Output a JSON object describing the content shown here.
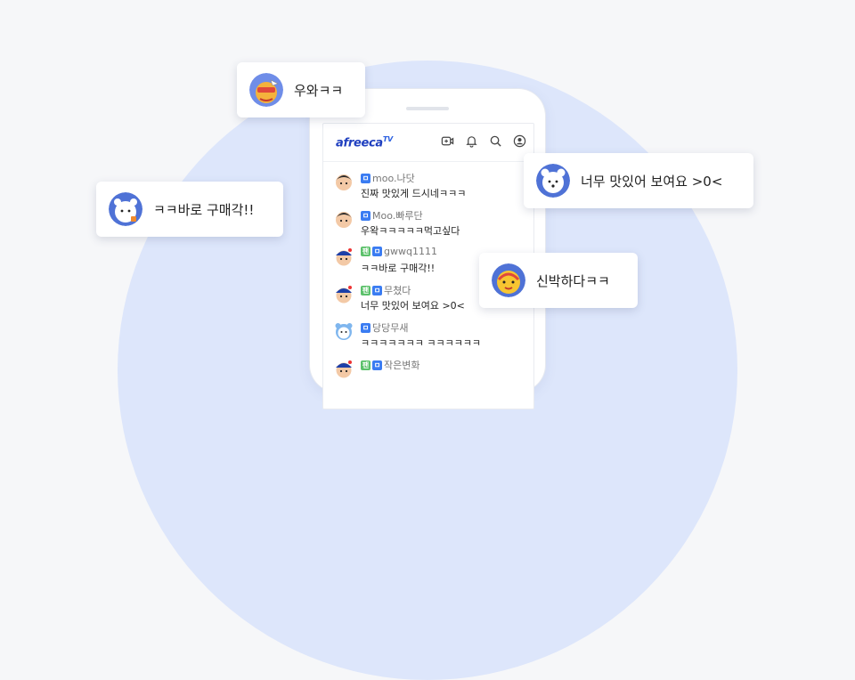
{
  "brand": {
    "logo": "afreeca",
    "logo_sup": "TV"
  },
  "topbar_icons": [
    "video-icon",
    "bell-icon",
    "search-icon",
    "profile-icon"
  ],
  "chat": [
    {
      "user": "moo.나닷",
      "text": "진짜 맛있게 드시네ㅋㅋㅋ",
      "badges": [
        "blue"
      ],
      "avatar": "boy"
    },
    {
      "user": "Moo.빠루단",
      "text": "우왁ㅋㅋㅋㅋㅋ먹고싶다",
      "badges": [
        "blue"
      ],
      "avatar": "boy"
    },
    {
      "user": "gwwq1111",
      "text": "ㅋㅋ바로 구매각!!",
      "badges": [
        "green",
        "blue"
      ],
      "avatar": "cap"
    },
    {
      "user": "무쳤다",
      "text": "너무 맛있어 보여요 >0<",
      "badges": [
        "green",
        "blue"
      ],
      "avatar": "cap"
    },
    {
      "user": "당당무새",
      "text": "ㅋㅋㅋㅋㅋㅋㅋ ㅋㅋㅋㅋㅋㅋ",
      "badges": [
        "blue"
      ],
      "avatar": "bear"
    },
    {
      "user": "작은변화",
      "text": "",
      "badges": [
        "green",
        "blue"
      ],
      "avatar": "cap"
    }
  ],
  "badge_labels": {
    "green": "팬",
    "blue": "ㅁ"
  },
  "bubbles": {
    "wow": "우와ㅋㅋ",
    "buy": "ㅋㅋ바로 구매각!!",
    "tasty": "너무 맛있어 보여요 >0<",
    "wonder": "신박하다ㅋㅋ"
  },
  "colors": {
    "accent": "#1f3fbf",
    "bg_circle": "#dde6fb",
    "badge_blue": "#3a7cf2",
    "badge_green": "#5cc16b"
  }
}
